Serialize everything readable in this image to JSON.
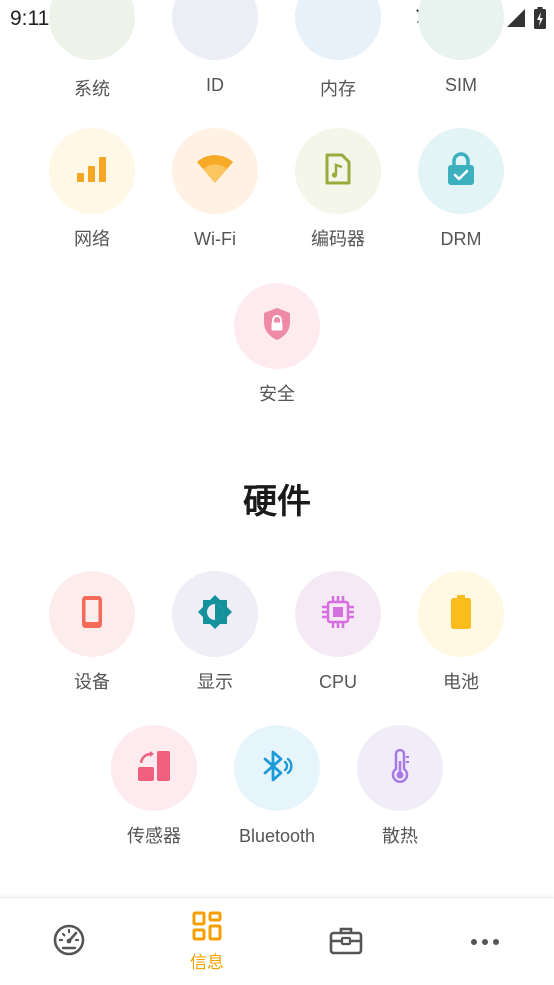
{
  "status_bar": {
    "time": "9:11"
  },
  "top_row": [
    {
      "label": "系统",
      "color": "#eef3ea"
    },
    {
      "label": "ID",
      "color": "#eceef6"
    },
    {
      "label": "内存",
      "color": "#e7f1fa"
    },
    {
      "label": "SIM",
      "color": "#e8f2ef"
    }
  ],
  "software_tiles": [
    {
      "label": "网络",
      "icon": "signal-bars-icon",
      "bg": "#fff8e6",
      "fg": "#f5a623"
    },
    {
      "label": "Wi-Fi",
      "icon": "wifi-icon",
      "bg": "#fff1e3",
      "fg": "#f7a928"
    },
    {
      "label": "编码器",
      "icon": "music-file-icon",
      "bg": "#f3f6e9",
      "fg": "#9aab3b"
    },
    {
      "label": "DRM",
      "icon": "lock-icon",
      "bg": "#e3f4f6",
      "fg": "#3db0c0"
    },
    {
      "label": "安全",
      "icon": "shield-lock-icon",
      "bg": "#fdebef",
      "fg": "#ee8aa6"
    }
  ],
  "hardware": {
    "title": "硬件",
    "tiles": [
      {
        "label": "设备",
        "icon": "phone-icon",
        "bg": "#fdecec",
        "fg": "#f46b5c"
      },
      {
        "label": "显示",
        "icon": "brightness-icon",
        "bg": "#efedf6",
        "fg": "#14929c"
      },
      {
        "label": "CPU",
        "icon": "cpu-chip-icon",
        "bg": "#f6e9f6",
        "fg": "#d66fe0"
      },
      {
        "label": "电池",
        "icon": "battery-icon",
        "bg": "#fff8e2",
        "fg": "#fbbd1c"
      },
      {
        "label": "传感器",
        "icon": "sensor-rotate-icon",
        "bg": "#fdebef",
        "fg": "#f15f7e"
      },
      {
        "label": "Bluetooth",
        "icon": "bluetooth-icon",
        "bg": "#e6f4fb",
        "fg": "#1d9ad9"
      },
      {
        "label": "散热",
        "icon": "thermometer-icon",
        "bg": "#f1edf8",
        "fg": "#a878e4"
      }
    ]
  },
  "bottom_nav": {
    "active_label": "信息",
    "active_color": "#f5a000",
    "inactive_color": "#555555"
  }
}
